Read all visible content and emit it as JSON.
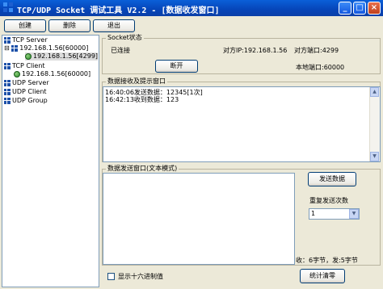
{
  "window": {
    "title": "TCP/UDP Socket 调试工具 V2.2 - [数据收发窗口]",
    "controls": {
      "minimize": "_",
      "maximize": "□",
      "close": "×"
    }
  },
  "toolbar": {
    "create": "创建",
    "delete": "删除",
    "exit": "退出"
  },
  "tree": {
    "tcp_server": "TCP Server",
    "tcp_server_child": "192.168.1.56[60000]",
    "tcp_server_grandchild": "192.168.1.56[4299]",
    "tcp_client": "TCP Client",
    "tcp_client_child": "192.168.1.56[60000]",
    "udp_server": "UDP Server",
    "udp_client": "UDP Client",
    "udp_group": "UDP Group",
    "expand_sign": "⊟"
  },
  "socket_status": {
    "title": "Socket状态",
    "state": "已连接",
    "remote_ip": "对方IP:192.168.1.56",
    "remote_port": "对方端口:4299",
    "disconnect": "断开",
    "local_port": "本地端口:60000"
  },
  "receive": {
    "title": "数据接收及提示窗口",
    "lines": [
      "16:40:06发送数据：12345[1次]",
      "16:42:13收到数据：123"
    ]
  },
  "send": {
    "title": "数据发送窗口(文本模式)",
    "send_button": "发送数据",
    "repeat_label": "重复发送次数",
    "repeat_value": "1",
    "status": "收：6字节，发:5字节"
  },
  "footer": {
    "hex_label": "显示十六进制值",
    "clear_button": "统计清零"
  }
}
